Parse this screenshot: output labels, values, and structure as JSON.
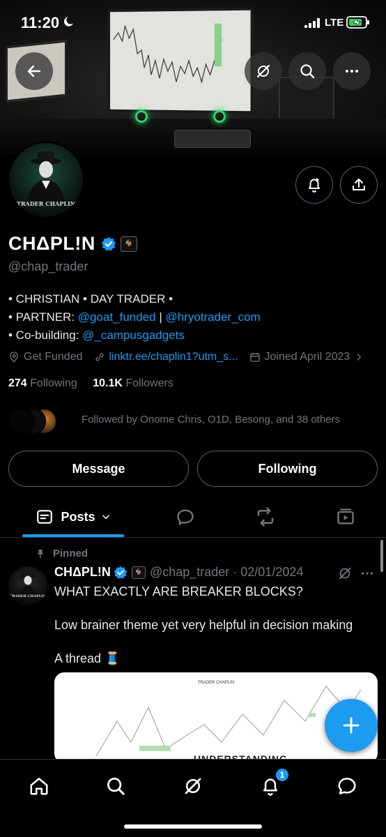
{
  "status": {
    "time": "11:20",
    "network": "LTE"
  },
  "profile": {
    "avatar_text": "TRADER CHAPLIN",
    "name": "CHΔPL!N",
    "affiliate_badge": "🐐",
    "handle": "@chap_trader",
    "bio": {
      "line1": "• CHRISTIAN • DAY TRADER •",
      "partner_prefix": "• PARTNER: ",
      "partner_link1": "@goat_funded",
      "partner_sep": " | ",
      "partner_link2": "@hryotrader_com",
      "cobuild_prefix": "• Co-building: ",
      "cobuild_link": "@_campusgadgets"
    },
    "location": "Get Funded",
    "website": "linktr.ee/chaplin1?utm_s...",
    "joined": "Joined April 2023",
    "following_count": "274",
    "following_label": "Following",
    "followers_count": "10.1K",
    "followers_label": "Followers",
    "followed_by": "Followed by Onome Chris, O1D, Besong, and 38 others"
  },
  "buttons": {
    "message": "Message",
    "following": "Following"
  },
  "tabs": {
    "posts": "Posts"
  },
  "post": {
    "pinned_label": "Pinned",
    "author": "CHΔPL!N",
    "handle_date": "@chap_trader · 02/01/2024",
    "avatar_text": "TRADER CHAPLIN",
    "line1": "WHAT EXACTLY ARE BREAKER BLOCKS?",
    "line2": "Low brainer theme yet very helpful in decision making",
    "line3": "A thread 🧵",
    "image_title": "TRADER CHAPLIN",
    "image_text": "UNDERSTANDING"
  },
  "nav": {
    "notification_count": "1"
  },
  "colors": {
    "accent": "#1d9bf0",
    "bg": "#000000",
    "muted": "#71767b",
    "text": "#e7e9ea"
  }
}
